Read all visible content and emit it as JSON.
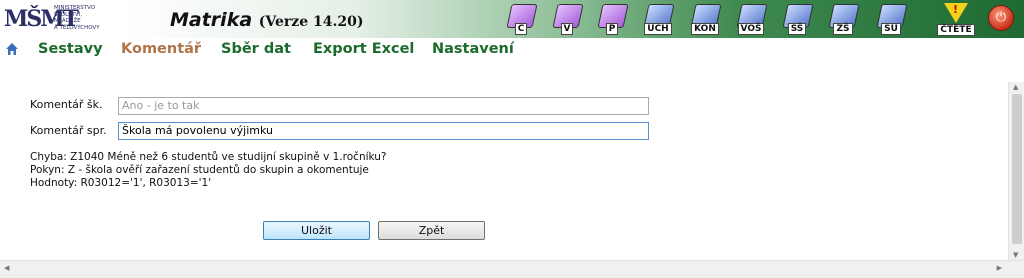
{
  "header": {
    "logo_mark": "MŠMT",
    "logo_lines": [
      "MINISTERSTVO",
      "ŠKOLSTVÍ,",
      "MLÁDEŽE",
      "A TĚLOVÝCHOVY"
    ],
    "title": "Matrika",
    "version": "(Verze 14.20)",
    "toolbar": [
      {
        "label": "C",
        "icon": "book-c-icon"
      },
      {
        "label": "V",
        "icon": "book-v-icon"
      },
      {
        "label": "P",
        "icon": "book-p-icon"
      },
      {
        "label": "UCH",
        "icon": "book-uch-icon"
      },
      {
        "label": "KON",
        "icon": "book-kon-icon"
      },
      {
        "label": "VOŠ",
        "icon": "book-vos-icon"
      },
      {
        "label": "SŠ",
        "icon": "book-ss-icon"
      },
      {
        "label": "ZŠ",
        "icon": "book-zs-icon"
      },
      {
        "label": "SU",
        "icon": "book-su-icon"
      }
    ],
    "warn_label": "ČTĚTE",
    "power_icon": "power-icon"
  },
  "menu": {
    "items": [
      "Sestavy",
      "Komentář",
      "Sběr dat",
      "Export Excel",
      "Nastavení"
    ],
    "active": "Komentář"
  },
  "form": {
    "label_school": "Komentář šk.",
    "placeholder_school": "Ano - je to tak",
    "label_admin": "Komentář spr.",
    "value_admin": "Škola má povolenu výjimku"
  },
  "messages": {
    "error": "Chyba: Z1040 Méně než 6 studentů ve studijní skupině v 1.ročníku?",
    "instruction": "Pokyn: Z - škola ověří zařazení studentů do skupin a okomentuje",
    "values": "Hodnoty: R03012='1', R03013='1'"
  },
  "buttons": {
    "save": "Uložit",
    "back": "Zpět"
  }
}
